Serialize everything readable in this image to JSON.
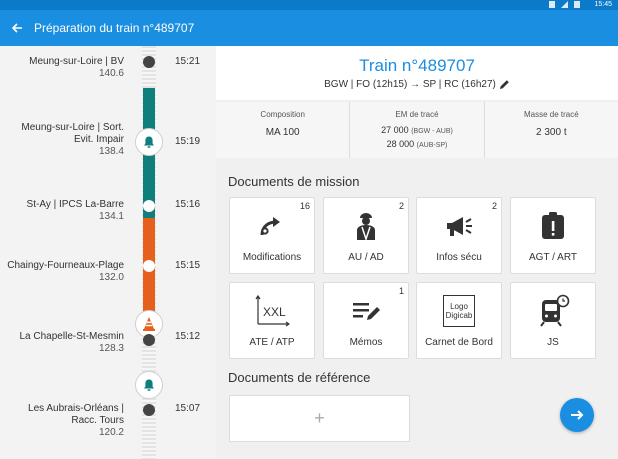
{
  "status_bar": {
    "time": "15:45"
  },
  "app_bar": {
    "title": "Préparation du train n°489707"
  },
  "timeline": {
    "stops": [
      {
        "name": "Meung-sur-Loire | BV",
        "km": "140.6",
        "time": "15:21"
      },
      {
        "name": "Meung-sur-Loire | Sort. Evit. Impair",
        "km": "138.4",
        "time": "15:19"
      },
      {
        "name": "St-Ay | IPCS La-Barre",
        "km": "134.1",
        "time": "15:16"
      },
      {
        "name": "Chaingy-Fourneaux-Plage",
        "km": "132.0",
        "time": "15:15"
      },
      {
        "name": "La Chapelle-St-Mesmin",
        "km": "128.3",
        "time": "15:12"
      },
      {
        "name": "Les Aubrais-Orléans | Racc. Tours",
        "km": "120.2",
        "time": "15:07"
      }
    ],
    "colors": {
      "teal": "#0f7f7c",
      "orange": "#e4601c"
    }
  },
  "train": {
    "title": "Train n°489707",
    "route": "BGW | FO (12h15) → SP | RC (16h27)"
  },
  "info": {
    "composition_label": "Composition",
    "composition_value": "MA 100",
    "em_label": "EM de tracé",
    "em_value_1": "27 000",
    "em_value_1_note": "(BGW - AUB)",
    "em_value_2": "28 000",
    "em_value_2_note": "(AUB-SP)",
    "masse_label": "Masse de tracé",
    "masse_value": "2 300 t"
  },
  "mission_docs": {
    "title": "Documents de mission",
    "tiles": [
      {
        "label": "Modifications",
        "badge": "16",
        "icon": "modifications-icon"
      },
      {
        "label": "AU / AD",
        "badge": "2",
        "icon": "agent-icon"
      },
      {
        "label": "Infos sécu",
        "badge": "2",
        "icon": "megaphone-icon"
      },
      {
        "label": "AGT / ART",
        "badge": "",
        "icon": "alert-badge-icon"
      },
      {
        "label": "ATE / ATP",
        "badge": "",
        "icon": "xxl-icon",
        "icon_text": "XXL"
      },
      {
        "label": "Mémos",
        "badge": "1",
        "icon": "memo-icon"
      },
      {
        "label": "Carnet de Bord",
        "badge": "",
        "icon": "logo-digicab-icon",
        "logo_text_1": "Logo",
        "logo_text_2": "Digicab"
      },
      {
        "label": "JS",
        "badge": "",
        "icon": "train-clock-icon"
      }
    ]
  },
  "reference_docs": {
    "title": "Documents de référence",
    "add_symbol": "+"
  },
  "colors": {
    "primary": "#1a8ee1",
    "status_bar": "#0b7ac9"
  }
}
